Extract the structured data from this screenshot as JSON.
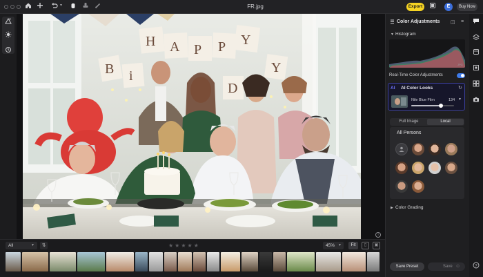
{
  "window": {
    "title": "FR.jpg"
  },
  "toolbar": {
    "export_label": "Export",
    "avatar_initial": "E",
    "buy_now_label": "Buy Now"
  },
  "panel": {
    "title": "Color Adjustments",
    "histogram_label": "Histogram",
    "realtime_label": "Real-Time Color Adjustments",
    "realtime_enabled": true,
    "ai_looks_title": "AI Color Looks",
    "look_name": "Nile Blue Film",
    "look_value": "134",
    "look_amount_fraction": 0.7,
    "tab_full_image": "Full Image",
    "tab_local": "Local",
    "active_tab": "Local",
    "persons_title": "All Persons",
    "color_grading_label": "Color Grading",
    "save_preset_label": "Save Preset",
    "save_label": "Save"
  },
  "filmstrip": {
    "filter_value": "All",
    "rating": 0,
    "rating_max": 5,
    "stars": "★★★★★",
    "zoom_value": "45%",
    "fit_label": "Fit"
  },
  "colors": {
    "accent_blue": "#3f7bea",
    "export_yellow": "#f5d323",
    "ai_border": "#3b3f9c"
  }
}
